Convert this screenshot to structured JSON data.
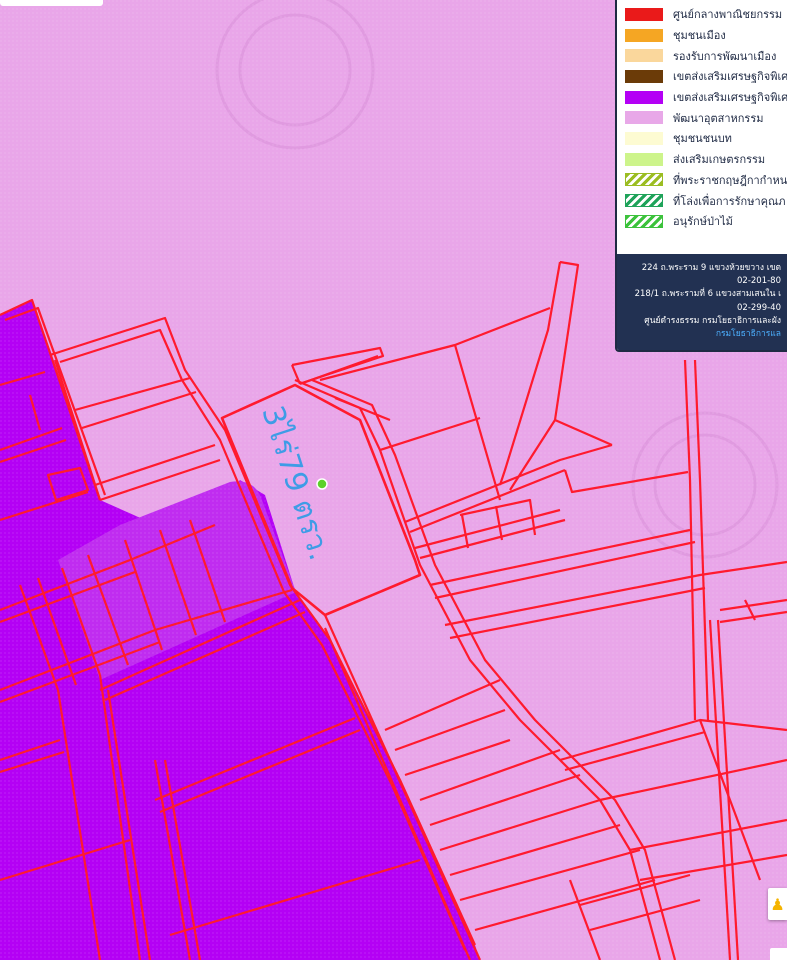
{
  "map": {
    "plot_annotation": "3ไร่79 ตรว.",
    "colors": {
      "industrial_zone": "#e9a6e9",
      "economic_zone": "#b400f5",
      "parcel_line": "#ff1a2e",
      "annotation": "#2c9be6",
      "pin": "#5bd12a"
    }
  },
  "legend": {
    "items": [
      {
        "label": "ศูนย์กลางพาณิชยกรรม",
        "color": "#ea1a1a",
        "pattern": "solid"
      },
      {
        "label": "ชุมชนเมือง",
        "color": "#f5a623",
        "pattern": "solid"
      },
      {
        "label": "รองรับการพัฒนาเมือง",
        "color": "#fad79c",
        "pattern": "solid"
      },
      {
        "label": "เขตส่งเสริมเศรษฐกิจพิเศษ",
        "color": "#6b3b08",
        "pattern": "solid"
      },
      {
        "label": "เขตส่งเสริมเศรษฐกิจพิเศษ",
        "color": "#b400f5",
        "pattern": "solid"
      },
      {
        "label": "พัฒนาอุตสาหกรรม",
        "color": "#e8a8e8",
        "pattern": "solid"
      },
      {
        "label": "ชุมชนชนบท",
        "color": "#fdfbd2",
        "pattern": "solid"
      },
      {
        "label": "ส่งเสริมเกษตรกรรม",
        "color": "#cdf48b",
        "pattern": "solid"
      },
      {
        "label": "ที่พระราชกฤษฎีกากำหน",
        "color": "#9bbd22",
        "pattern": "hatch"
      },
      {
        "label": "ที่โล่งเพื่อการรักษาคุณภ",
        "color": "#1fa35a",
        "pattern": "hatch"
      },
      {
        "label": "อนุรักษ์ป่าไม้",
        "color": "#3cc23c",
        "pattern": "hatch"
      }
    ],
    "footer": {
      "line1": "224 ถ.พระราม 9 แขวงห้วยขวาง เขต",
      "line2": "02-201-80",
      "line3": "218/1 ถ.พระรามที่ 6 แขวงสามเสนใน เ",
      "line4": "02-299-40",
      "line5": "ศูนย์ดำรงธรรม กรมโยธาธิการและผัง",
      "link": "กรมโยธาธิการแล"
    }
  },
  "controls": {
    "pegman_icon": "pegman-icon"
  }
}
